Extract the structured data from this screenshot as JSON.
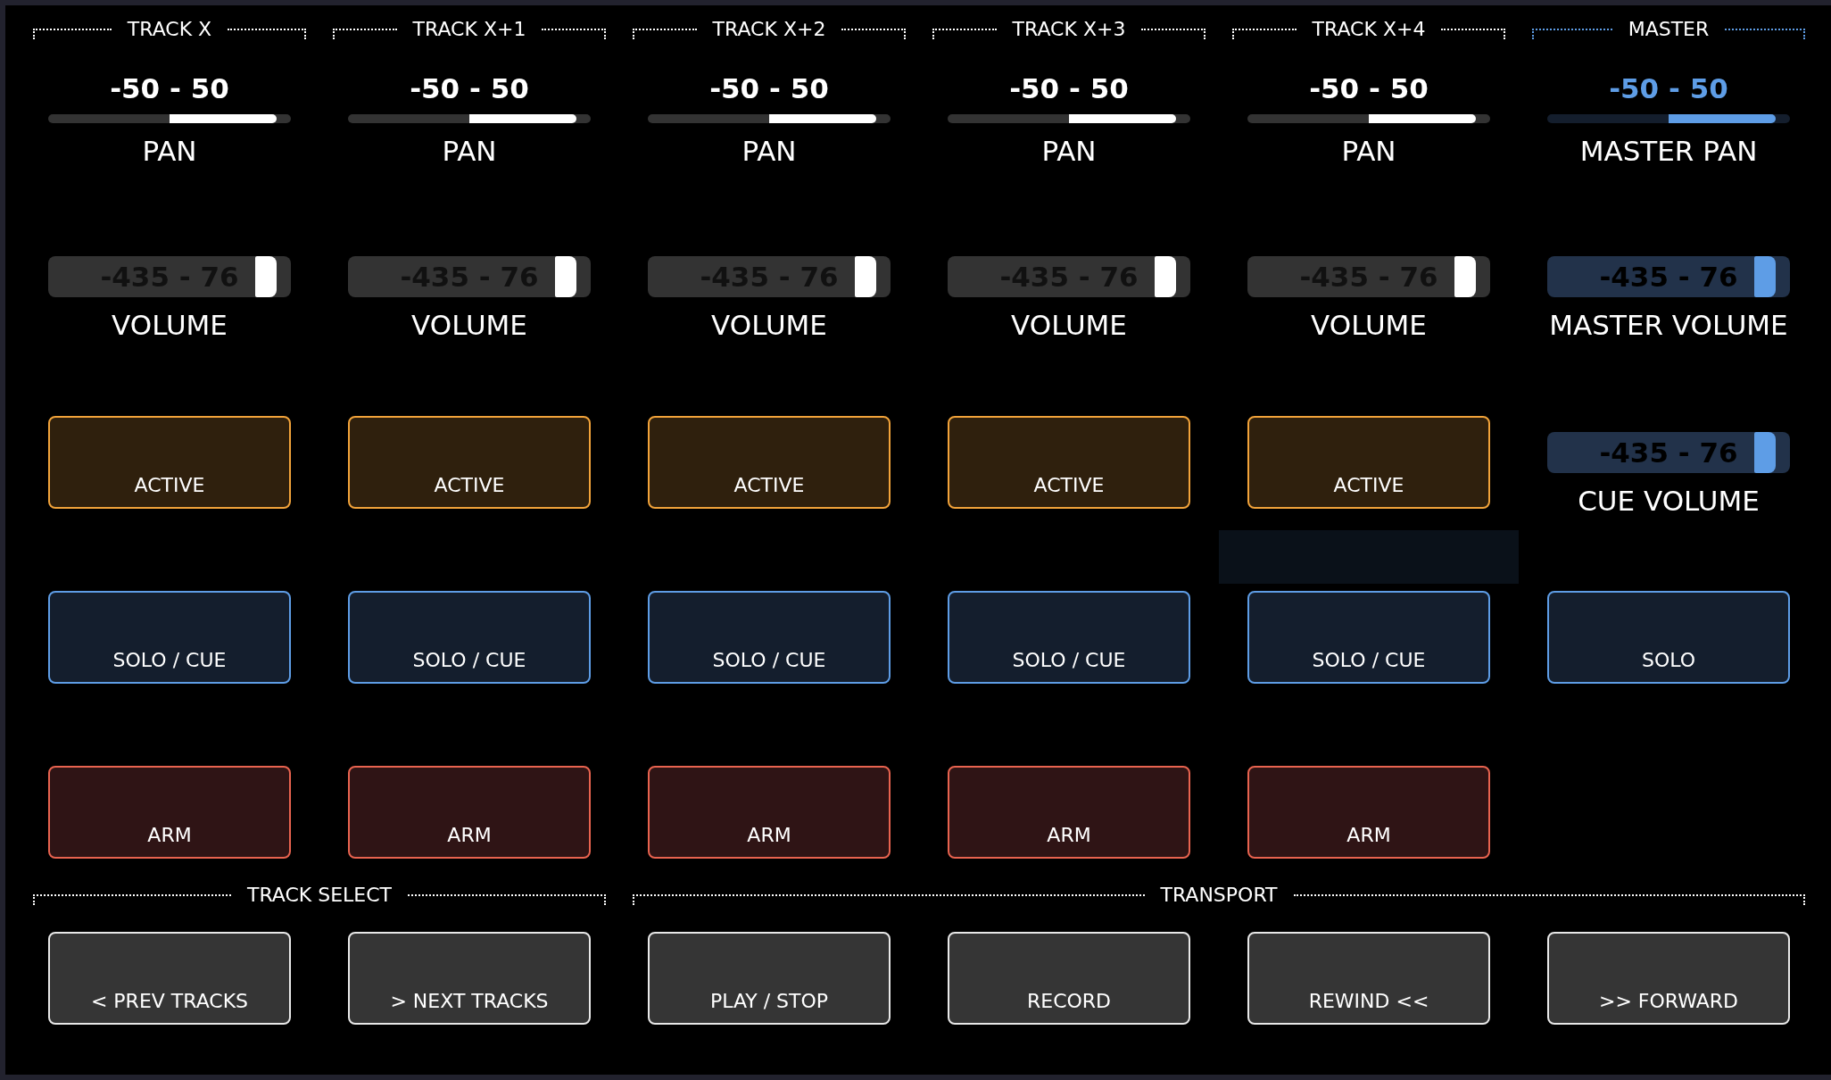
{
  "strips": [
    {
      "kind": "track",
      "title": "TRACK X",
      "pan": {
        "value": "-50 - 50",
        "level": 0.94,
        "label": "PAN"
      },
      "volume": {
        "value": "-435 - 76",
        "level": 0.94,
        "label": "VOLUME"
      },
      "active": "ACTIVE",
      "empty_slot": false,
      "solo": "SOLO / CUE",
      "arm": "ARM"
    },
    {
      "kind": "track",
      "title": "TRACK X+1",
      "pan": {
        "value": "-50 - 50",
        "level": 0.94,
        "label": "PAN"
      },
      "volume": {
        "value": "-435 - 76",
        "level": 0.94,
        "label": "VOLUME"
      },
      "active": "ACTIVE",
      "empty_slot": false,
      "solo": "SOLO / CUE",
      "arm": "ARM"
    },
    {
      "kind": "track",
      "title": "TRACK X+2",
      "pan": {
        "value": "-50 - 50",
        "level": 0.94,
        "label": "PAN"
      },
      "volume": {
        "value": "-435 - 76",
        "level": 0.94,
        "label": "VOLUME"
      },
      "active": "ACTIVE",
      "empty_slot": false,
      "solo": "SOLO / CUE",
      "arm": "ARM"
    },
    {
      "kind": "track",
      "title": "TRACK X+3",
      "pan": {
        "value": "-50 - 50",
        "level": 0.94,
        "label": "PAN"
      },
      "volume": {
        "value": "-435 - 76",
        "level": 0.94,
        "label": "VOLUME"
      },
      "active": "ACTIVE",
      "empty_slot": false,
      "solo": "SOLO / CUE",
      "arm": "ARM"
    },
    {
      "kind": "track",
      "title": "TRACK X+4",
      "pan": {
        "value": "-50 - 50",
        "level": 0.94,
        "label": "PAN"
      },
      "volume": {
        "value": "-435 - 76",
        "level": 0.94,
        "label": "VOLUME"
      },
      "active": "ACTIVE",
      "empty_slot": true,
      "solo": "SOLO / CUE",
      "arm": "ARM"
    },
    {
      "kind": "master",
      "title": "MASTER",
      "pan": {
        "value": "-50 - 50",
        "level": 0.94,
        "label": "MASTER PAN"
      },
      "volume": {
        "value": "-435 - 76",
        "level": 0.94,
        "label": "MASTER VOLUME"
      },
      "cue_volume": {
        "value": "-435 - 76",
        "level": 0.94,
        "label": "CUE VOLUME"
      },
      "solo": "SOLO"
    }
  ],
  "sections": [
    {
      "title": "TRACK SELECT",
      "buttons": [
        "< PREV TRACKS",
        "> NEXT TRACKS"
      ]
    },
    {
      "title": "TRANSPORT",
      "buttons": [
        "PLAY / STOP",
        "RECORD",
        "REWIND <<",
        ">> FORWARD"
      ]
    }
  ]
}
